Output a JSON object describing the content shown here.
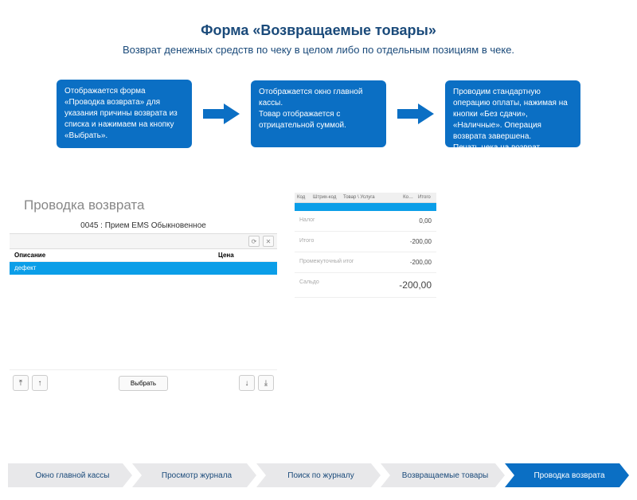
{
  "title": "Форма «Возвращаемые товары»",
  "subtitle": "Возврат денежных средств по чеку в целом либо по отдельным позициям в чеке.",
  "flow": {
    "box1": "Отображается форма «Проводка возврата» для указания причины возврата из списка и нажимаем  на кнопку «Выбрать».",
    "box2": "Отображается окно главной кассы.\nТовар отображается с отрицательной суммой.",
    "box3": "Проводим стандартную операцию оплаты, нажимая на кнопки «Без сдачи», «Наличные». Операция возврата завершена.\nПечать чека на возврат"
  },
  "colors": {
    "brand": "#0b6fc4",
    "accent": "#0b9ee8"
  },
  "screenshot1": {
    "window_title": "Проводка возврата",
    "item_line": "0045 : Прием EMS Обыкновенное",
    "head_col1": "Описание",
    "head_col2": "Цена",
    "row1": "дефект",
    "select_button": "Выбрать"
  },
  "screenshot2": {
    "head": {
      "c1": "Код",
      "c2": "Штрих-код",
      "c3": "Товар \\ Услуга",
      "c4": "Ко…",
      "c5": "Итого"
    },
    "lines": [
      {
        "label": "Налог",
        "value": "0,00"
      },
      {
        "label": "Итого",
        "value": "-200,00"
      },
      {
        "label": "Промежуточный итог",
        "value": "-200,00"
      },
      {
        "label": "Сальдо",
        "value": "-200,00",
        "big": true
      }
    ]
  },
  "stepper": {
    "items": [
      "Окно главной кассы",
      "Просмотр журнала",
      "Поиск по журналу",
      "Возвращаемые товары",
      "Проводка возврата"
    ],
    "active_index": 4
  }
}
